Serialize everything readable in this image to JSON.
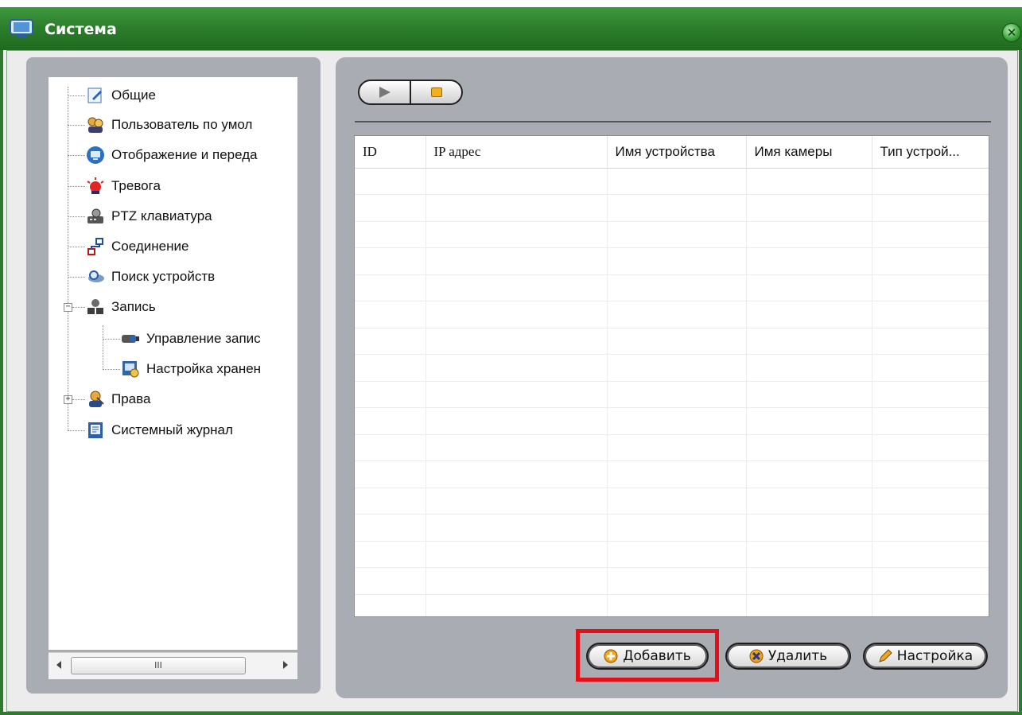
{
  "window": {
    "title": "Система"
  },
  "tree": [
    {
      "label": "Общие",
      "icon": "edit-document-icon"
    },
    {
      "label": "Пользователь по умол",
      "icon": "users-icon"
    },
    {
      "label": "Отображение и переда",
      "icon": "monitor-icon"
    },
    {
      "label": "Тревога",
      "icon": "alarm-siren-icon"
    },
    {
      "label": "PTZ клавиатура",
      "icon": "ptz-keyboard-icon"
    },
    {
      "label": "Соединение",
      "icon": "network-connection-icon"
    },
    {
      "label": "Поиск устройств",
      "icon": "device-search-icon"
    },
    {
      "label": "Запись",
      "icon": "recording-icon",
      "expanded": true
    },
    {
      "label": "Управление запис",
      "icon": "camera-icon",
      "child": true
    },
    {
      "label": "Настройка хранен",
      "icon": "storage-settings-icon",
      "child": true
    },
    {
      "label": "Права",
      "icon": "user-rights-icon",
      "expanded": false
    },
    {
      "label": "Системный журнал",
      "icon": "system-log-icon"
    }
  ],
  "scrollbar": {
    "thumb_grip": "III"
  },
  "toolbar": {
    "play_icon": "play-icon",
    "stop_icon": "stop-icon"
  },
  "table": {
    "columns": [
      "ID",
      "IP адрес",
      "Имя устройства",
      "Имя камеры",
      "Тип устрой..."
    ],
    "rows": []
  },
  "buttons": {
    "add": "Добавить",
    "delete": "Удалить",
    "settings": "Настройка"
  },
  "colors": {
    "titlebar": "#2d7f2d",
    "panel": "#a9acb3",
    "highlight": "#e3101a"
  }
}
